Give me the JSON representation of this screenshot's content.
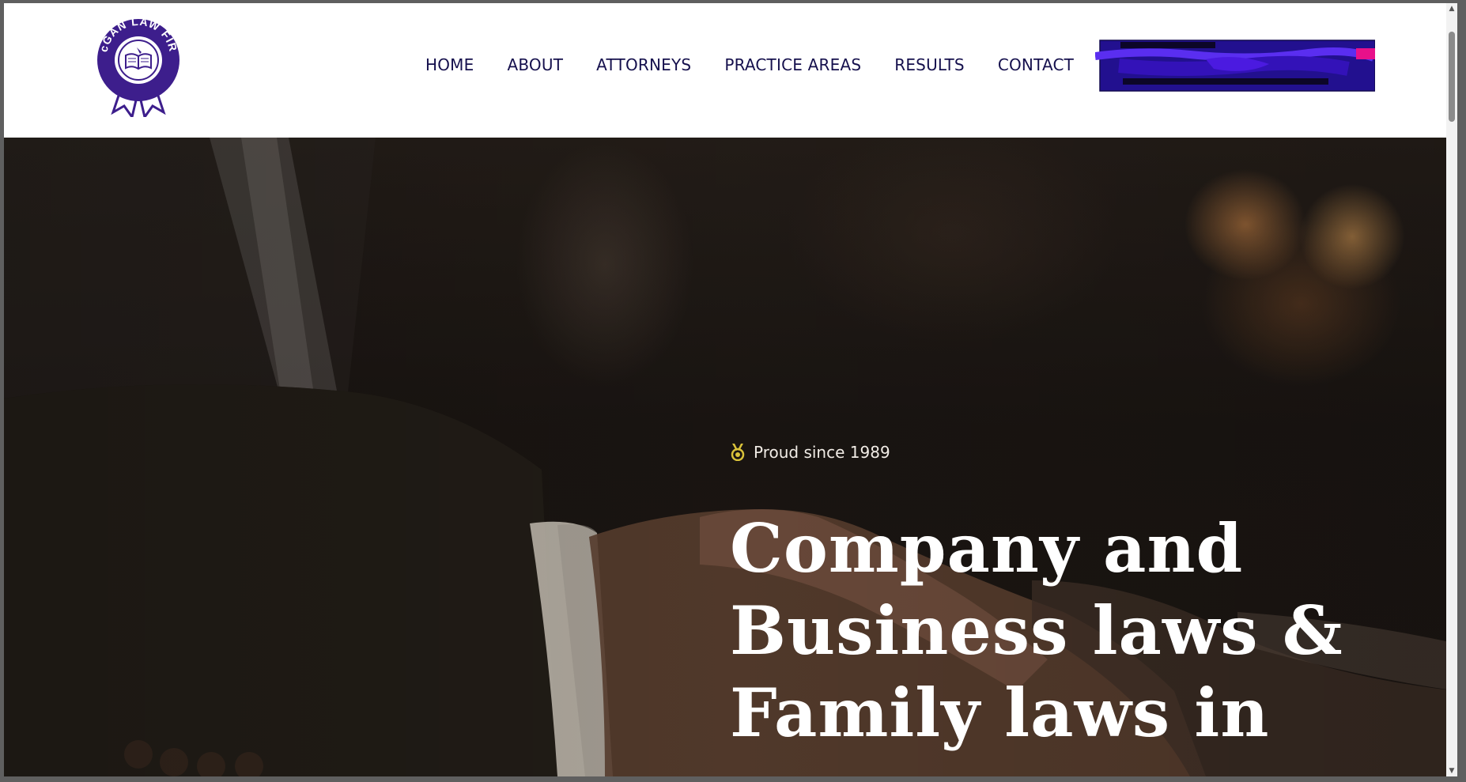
{
  "header": {
    "logo": {
      "text": "McGAN LAW FIRM",
      "alt": "McGan Law Firm logo"
    },
    "nav": [
      {
        "label": "HOME"
      },
      {
        "label": "ABOUT"
      },
      {
        "label": "ATTORNEYS"
      },
      {
        "label": "PRACTICE AREAS"
      },
      {
        "label": "RESULTS"
      },
      {
        "label": "CONTACT"
      }
    ],
    "cta": {
      "label": "",
      "state": "redacted"
    }
  },
  "hero": {
    "tagline": "Proud since 1989",
    "headline_lines": [
      "Company and",
      "Business laws &",
      "Family laws in"
    ]
  },
  "colors": {
    "brand_purple": "#3d1e8c",
    "nav_text": "#15104d",
    "cta_fill": "#1a0aa8",
    "highlight_magenta": "#e8108a",
    "medal_gold": "#d9c23a",
    "hero_text": "#ffffff"
  },
  "icons": {
    "tagline_icon": "medal-icon",
    "logo_icon": "open-book-icon"
  }
}
